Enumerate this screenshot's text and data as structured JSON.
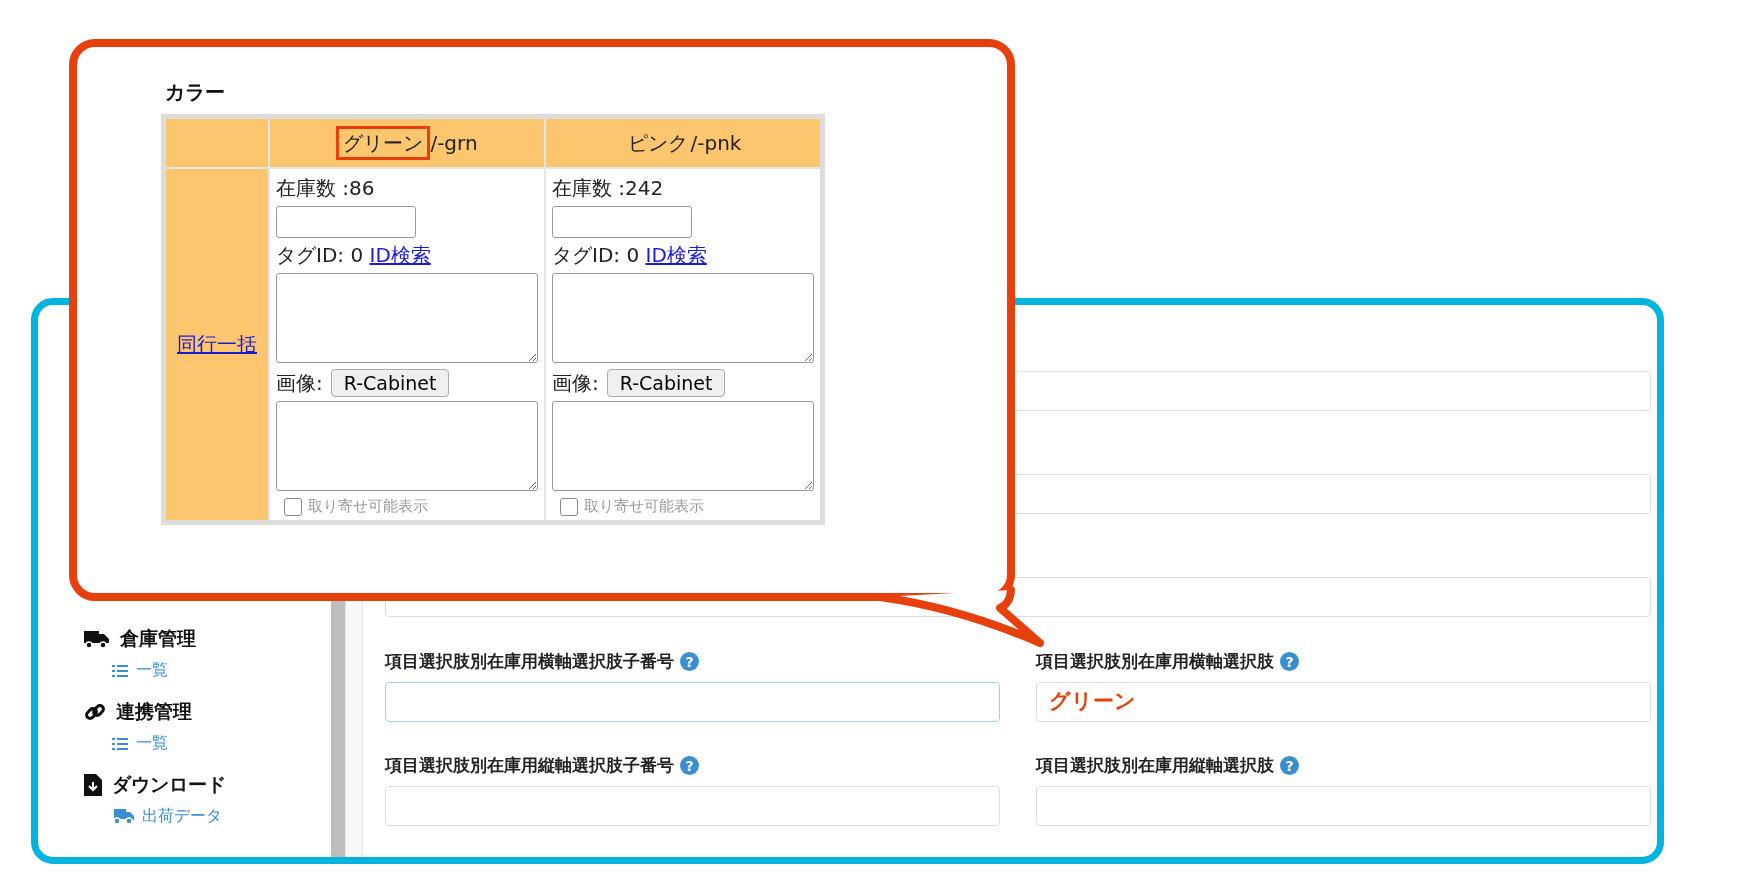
{
  "sidebar": {
    "sections": [
      {
        "kind": "truck",
        "title": "倉庫管理",
        "items": [
          {
            "kind": "list",
            "label": "一覧"
          }
        ]
      },
      {
        "kind": "link",
        "title": "連携管理",
        "items": [
          {
            "kind": "list",
            "label": "一覧"
          }
        ]
      },
      {
        "kind": "download",
        "title": "ダウンロード",
        "items": [
          {
            "kind": "truck",
            "label": "出荷データ"
          }
        ]
      }
    ]
  },
  "form": {
    "hidden_rows": [
      {
        "kind": "full"
      },
      {
        "kind": "full"
      },
      {
        "kind": "full"
      }
    ],
    "rows": [
      [
        {
          "label": "項目選択肢別在庫用横軸選択肢子番号",
          "help": "?",
          "focused": true
        },
        {
          "label": "項目選択肢別在庫用横軸選択肢",
          "help": "?",
          "value": "グリーン",
          "focused": false
        }
      ],
      [
        {
          "label": "項目選択肢別在庫用縦軸選択肢子番号",
          "help": "?",
          "focused": false
        },
        {
          "label": "項目選択肢別在庫用縦軸選択肢",
          "help": "?",
          "focused": false
        }
      ]
    ]
  },
  "callout": {
    "section_title": "カラー",
    "row_link": "同行一括",
    "columns": [
      {
        "name": "グリーン",
        "code": "/-grn",
        "highlighted": true,
        "stock": "在庫数 :86",
        "tag": "タグID: 0",
        "tag_link": "ID検索",
        "image_label": "画像:",
        "image_button": "R-Cabinet",
        "checkbox_label": "取り寄せ可能表示",
        "checked": false
      },
      {
        "name": "ピンク",
        "code": "/-pnk",
        "highlighted": false,
        "stock": "在庫数 :242",
        "tag": "タグID: 0",
        "tag_link": "ID検索",
        "image_label": "画像:",
        "image_button": "R-Cabinet",
        "checkbox_label": "取り寄せ可能表示",
        "checked": false
      }
    ]
  }
}
